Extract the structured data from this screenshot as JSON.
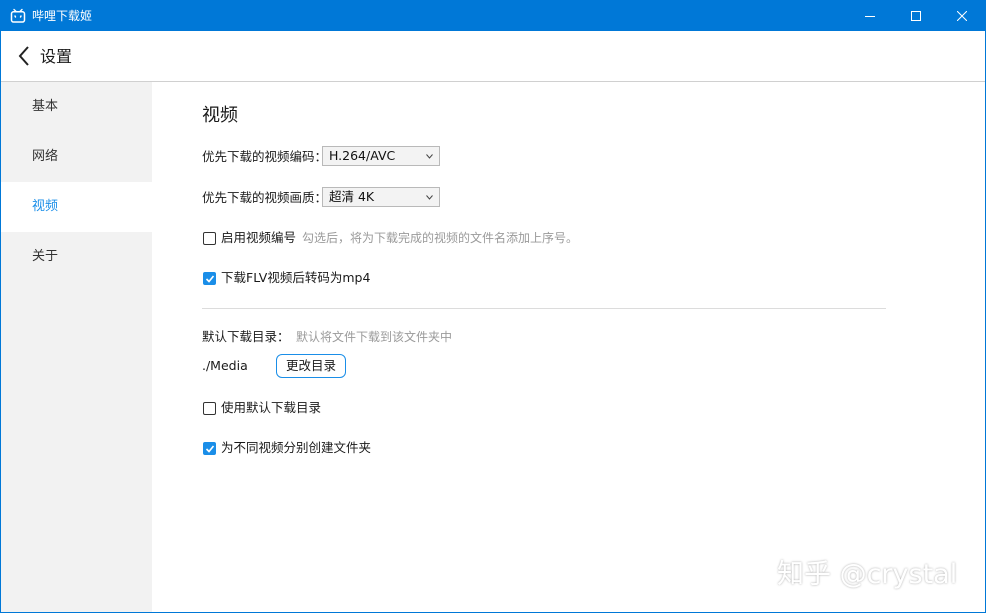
{
  "window": {
    "title": "哔哩下载姬",
    "controls": {
      "minimize": "minimize-icon",
      "maximize": "maximize-icon",
      "close": "close-icon"
    }
  },
  "header": {
    "back_icon": "chevron-left-icon",
    "title": "设置"
  },
  "sidebar": {
    "items": [
      {
        "label": "基本"
      },
      {
        "label": "网络"
      },
      {
        "label": "视频",
        "active": true
      },
      {
        "label": "关于"
      }
    ]
  },
  "content": {
    "section_title": "视频",
    "codec": {
      "label": "优先下载的视频编码：",
      "value": "H.264/AVC"
    },
    "quality": {
      "label": "优先下载的视频画质：",
      "value": "超清 4K"
    },
    "enable_numbering": {
      "label": "启用视频编号",
      "checked": false,
      "hint": "勾选后，将为下载完成的视频的文件名添加上序号。"
    },
    "flv_to_mp4": {
      "label": "下载FLV视频后转码为mp4",
      "checked": true
    },
    "default_dir": {
      "label": "默认下载目录：",
      "hint": "默认将文件下载到该文件夹中",
      "path": "./Media",
      "change_button": "更改目录"
    },
    "use_default_dir": {
      "label": "使用默认下载目录",
      "checked": false
    },
    "create_folders": {
      "label": "为不同视频分别创建文件夹",
      "checked": true
    }
  },
  "watermark": "知乎 @crystal",
  "colors": {
    "titlebar": "#0078d7",
    "accent": "#1a8ee8",
    "sidebar_bg": "#f2f2f2"
  }
}
